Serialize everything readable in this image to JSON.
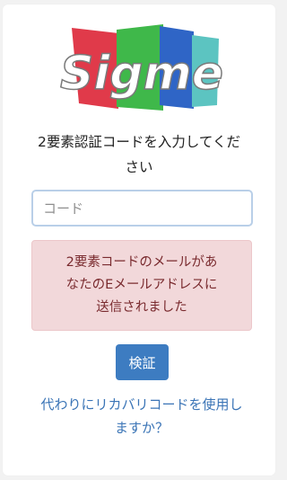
{
  "logo": {
    "text": "Sigme",
    "colors": {
      "red": "#e03a4a",
      "green": "#3fb84a",
      "blue": "#2f65c6",
      "teal": "#5cc4c1"
    }
  },
  "prompt": {
    "line1": "2要素認証コードを入力してくだ",
    "line2": "さい"
  },
  "code_input": {
    "placeholder": "コード",
    "value": ""
  },
  "alert": {
    "line1": "2要素コードのメールがあ",
    "line2": "なたのEメールアドレスに",
    "line3": "送信されました"
  },
  "verify_button": {
    "label": "検証"
  },
  "recovery_link": {
    "line1": "代わりにリカバリコードを使用し",
    "line2": "ますか？"
  }
}
